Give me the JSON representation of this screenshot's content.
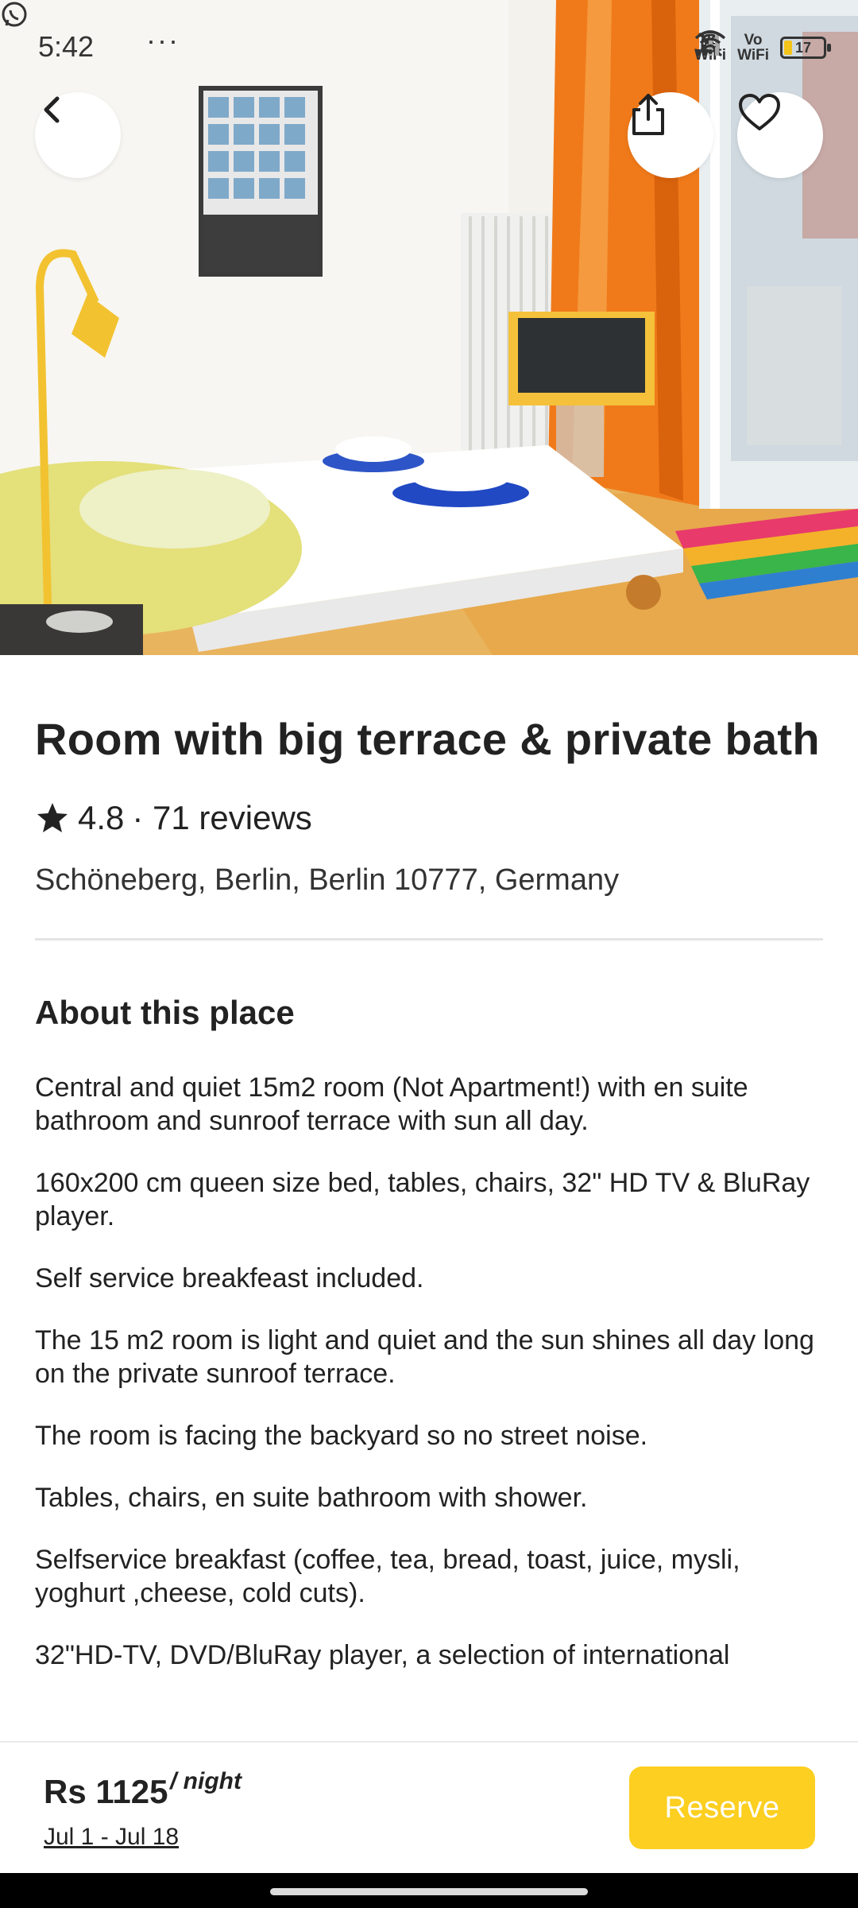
{
  "status_bar": {
    "time": "5:42",
    "dots": "···",
    "vo_wifi_1": "Vo\nWiFi",
    "vo_wifi_2": "Vo\nWiFi",
    "battery": "17"
  },
  "hero": {
    "photo_alt": "Bright room with bed, lamp, TV, orange curtain and terrace door"
  },
  "listing": {
    "title": "Room with big terrace & private bath",
    "rating": "4.8",
    "reviews": "· 71 reviews",
    "location": "Schöneberg, Berlin, Berlin 10777, Germany"
  },
  "about": {
    "heading": "About this place",
    "paragraphs": [
      "Central and quiet 15m2 room (Not Apartment!) with en suite bathroom and sunroof terrace with sun all day.",
      "160x200 cm queen size bed, tables, chairs,  32\" HD TV & BluRay player.",
      "Self service breakfeast included.",
      "The 15 m2 room is light and quiet and the sun shines all day long on the private sunroof terrace.",
      "The room is facing the backyard so no street noise.",
      "Tables, chairs, en suite bathroom with shower.",
      "Selfservice breakfast (coffee, tea, bread, toast, juice, mysli, yoghurt ,cheese, cold cuts).",
      "32\"HD-TV, DVD/BluRay player, a selection of international"
    ]
  },
  "booking": {
    "price": "Rs 1125",
    "per_night": "/ night",
    "dates": "Jul 1 - Jul 18",
    "reserve_label": "Reserve"
  },
  "colors": {
    "accent": "#fccf20",
    "text": "#222222",
    "divider": "#e4e4e4"
  },
  "icons": [
    "whatsapp-icon",
    "back-arrow-icon",
    "share-icon",
    "heart-icon",
    "star-icon",
    "signal-icon",
    "wifi-icon",
    "battery-icon",
    "mute-icon"
  ]
}
